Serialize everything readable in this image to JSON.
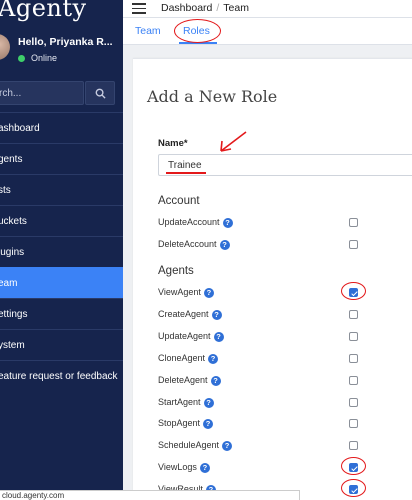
{
  "app": {
    "brand": "Agenty"
  },
  "user": {
    "greeting": "Hello, Priyanka R...",
    "status": "Online"
  },
  "search": {
    "placeholder": "rch...",
    "icon": "search-icon"
  },
  "sidebar": {
    "items": [
      {
        "label": "ashboard",
        "active": false
      },
      {
        "label": "gents",
        "active": false
      },
      {
        "label": "sts",
        "active": false
      },
      {
        "label": "uckets",
        "active": false
      },
      {
        "label": "lugins",
        "active": false
      },
      {
        "label": "eam",
        "active": true
      },
      {
        "label": "ettings",
        "active": false
      },
      {
        "label": "ystem",
        "active": false
      },
      {
        "label": "eature request or feedback",
        "active": false
      }
    ]
  },
  "topbar": {
    "breadcrumb": [
      "Dashboard",
      "Team"
    ],
    "separator": "/"
  },
  "tabs": [
    {
      "label": "Team",
      "active": false
    },
    {
      "label": "Roles",
      "active": true
    }
  ],
  "form": {
    "title": "Add a New Role",
    "name_label": "Name*",
    "name_value": "Trainee"
  },
  "sections": [
    {
      "heading": "Account",
      "permissions": [
        {
          "label": "UpdateAccount",
          "checked": false
        },
        {
          "label": "DeleteAccount",
          "checked": false
        }
      ]
    },
    {
      "heading": "Agents",
      "permissions": [
        {
          "label": "ViewAgent",
          "checked": true
        },
        {
          "label": "CreateAgent",
          "checked": false
        },
        {
          "label": "UpdateAgent",
          "checked": false
        },
        {
          "label": "CloneAgent",
          "checked": false
        },
        {
          "label": "DeleteAgent",
          "checked": false
        },
        {
          "label": "StartAgent",
          "checked": false
        },
        {
          "label": "StopAgent",
          "checked": false
        },
        {
          "label": "ScheduleAgent",
          "checked": false
        },
        {
          "label": "ViewLogs",
          "checked": true
        },
        {
          "label": "ViewResult",
          "checked": true
        }
      ]
    }
  ],
  "help_icon": {
    "glyph": "?",
    "color": "#2f6fd6"
  },
  "statusbar": {
    "text": "cloud.agenty.com"
  },
  "colors": {
    "sidebar": "#16244d",
    "accent": "#3b82f6",
    "annotation": "#e3191b"
  }
}
